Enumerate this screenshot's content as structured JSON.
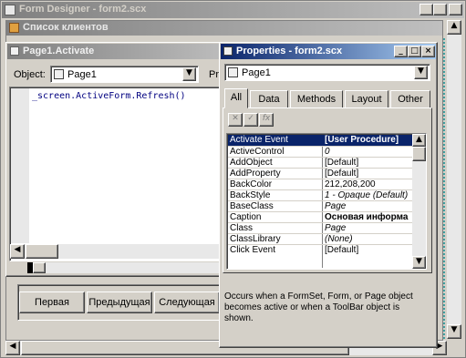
{
  "designer": {
    "title": "Form Designer - form2.scx",
    "form_caption": "Список клиентов"
  },
  "code": {
    "title": "Page1.Activate",
    "object_label": "Object:",
    "object_value": "Page1",
    "proc_label": "Pr",
    "line1": "_screen.ActiveForm.Refresh()"
  },
  "form": {
    "buttons": [
      "Первая",
      "Предыдущая",
      "Следующая"
    ]
  },
  "props": {
    "title": "Properties - form2.scx",
    "object_value": "Page1",
    "tabs": [
      "All",
      "Data",
      "Methods",
      "Layout",
      "Other"
    ],
    "rows": [
      {
        "name": "Activate Event",
        "value": "[User Procedure]",
        "selected": true
      },
      {
        "name": "ActiveControl",
        "value": "0"
      },
      {
        "name": "AddObject",
        "value": "[Default]"
      },
      {
        "name": "AddProperty",
        "value": "[Default]"
      },
      {
        "name": "BackColor",
        "value": "212,208,200"
      },
      {
        "name": "BackStyle",
        "value": "1 - Opaque (Default)",
        "italic": true
      },
      {
        "name": "BaseClass",
        "value": "Page",
        "italic": true
      },
      {
        "name": "Caption",
        "value": "Основая информа",
        "bold": true
      },
      {
        "name": "Class",
        "value": "Page",
        "italic": true
      },
      {
        "name": "ClassLibrary",
        "value": "(None)",
        "italic": true
      },
      {
        "name": "Click Event",
        "value": "[Default]"
      }
    ],
    "description": "Occurs when a FormSet, Form, or Page object becomes active or when a ToolBar object is shown."
  }
}
